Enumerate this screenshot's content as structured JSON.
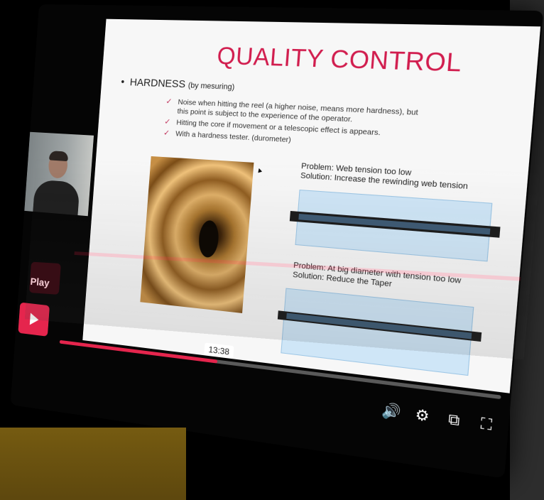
{
  "slide": {
    "title": "QUALITY CONTROL",
    "bullet_main": "HARDNESS",
    "bullet_main_note": "(by mesuring)",
    "sub_items": [
      "Noise when hitting the reel (a higher noise, means more hardness), but this point is subject to the experience of the operator.",
      "Hitting the core if movement or a telescopic effect is appears.",
      "With a hardness tester. (durometer)"
    ],
    "problem1_line1": "Problem: Web tension too low",
    "problem1_line2": "Solution: Increase the rewinding web tension",
    "problem2_line1": "Problem: At big diameter with tension too low",
    "problem2_line2": "Solution: Reduce the Taper"
  },
  "player": {
    "play_label": "Play",
    "time_tooltip": "13:38",
    "progress_fraction": 0.39,
    "accent_color": "#e5254d",
    "icons": [
      "play-icon",
      "volume-icon",
      "settings-gear-icon",
      "picture-in-picture-icon",
      "fullscreen-icon"
    ]
  }
}
